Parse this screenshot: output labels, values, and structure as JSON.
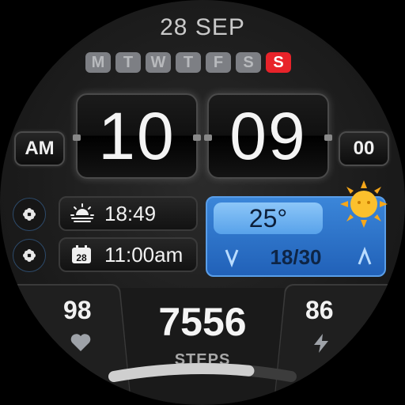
{
  "date": "28 SEP",
  "weekdays": [
    {
      "label": "M",
      "active": false
    },
    {
      "label": "T",
      "active": false
    },
    {
      "label": "W",
      "active": false
    },
    {
      "label": "T",
      "active": false
    },
    {
      "label": "F",
      "active": false
    },
    {
      "label": "S",
      "active": false
    },
    {
      "label": "S",
      "active": true
    }
  ],
  "time": {
    "hours": "10",
    "minutes": "09",
    "ampm": "AM",
    "seconds": "00"
  },
  "sunrise": {
    "icon": "sunrise-icon",
    "value": "18:49"
  },
  "event": {
    "icon": "calendar-icon",
    "day": "28",
    "value": "11:00am"
  },
  "weather": {
    "temp": "25°",
    "minmax": "18/30",
    "icon": "sun-icon"
  },
  "heart_rate": {
    "value": "98",
    "icon": "heart-icon"
  },
  "steps": {
    "value": "7556",
    "label": "STEPS",
    "progress": 0.76
  },
  "battery": {
    "value": "86",
    "icon": "lightning-icon"
  },
  "colors": {
    "accent_red": "#e8232a",
    "weather_blue": "#2a6fc4",
    "day_chip": "#7d7f84"
  }
}
